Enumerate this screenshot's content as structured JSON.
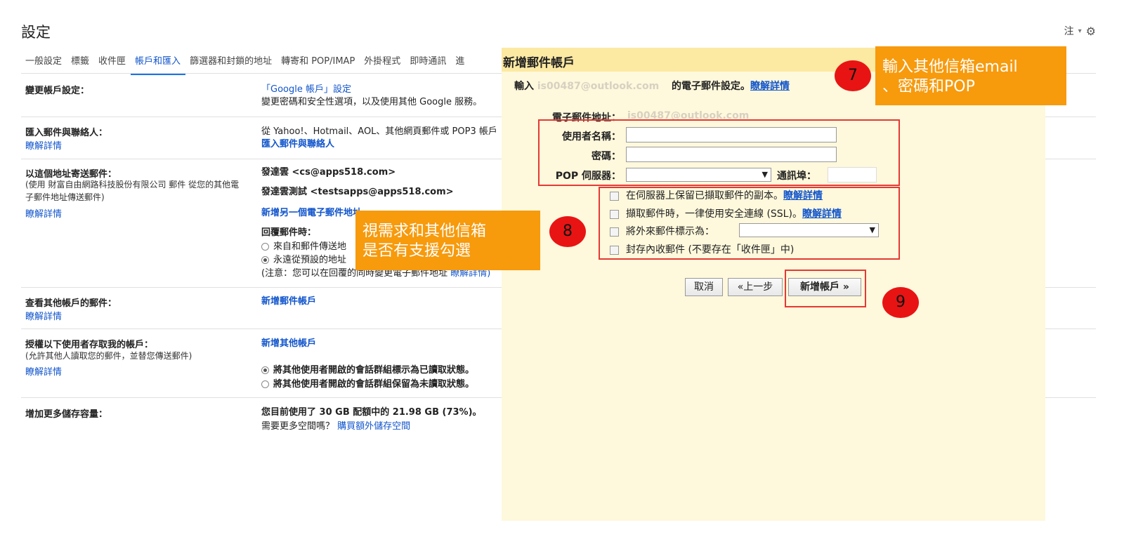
{
  "header": {
    "title": "設定",
    "notes_label": "注",
    "dropdown_caret": "▾"
  },
  "tabs": [
    "一般設定",
    "標籤",
    "收件匣",
    "帳戶和匯入",
    "篩選器和封鎖的地址",
    "轉寄和 POP/IMAP",
    "外掛程式",
    "即時通訊",
    "進"
  ],
  "active_tab_index": 3,
  "sections": {
    "change_account": {
      "title": "變更帳戶設定：",
      "link": "「Google 帳戶」設定",
      "desc": "變更密碼和安全性選項，以及使用其他 Google 服務。"
    },
    "import": {
      "title": "匯入郵件與聯絡人：",
      "learn": "瞭解詳情",
      "desc": "從 Yahoo!、Hotmail、AOL、其他網頁郵件或 POP3 帳戶",
      "link": "匯入郵件與聯絡人"
    },
    "send_as": {
      "title": "以這個地址寄送郵件：",
      "sub1": "(使用 財富自由網路科技股份有限公司 郵件 從您的其他電",
      "sub2": "子郵件地址傳送郵件)",
      "learn": "瞭解詳情",
      "addr1": "發達雲 <cs@apps518.com>",
      "addr2": "發達雲測試 <testsapps@apps518.com>",
      "add_link": "新增另一個電子郵件地址",
      "reply_title": "回覆郵件時：",
      "reply_opt1": "來自和郵件傳送地",
      "reply_opt2": "永遠從預設的地址",
      "note": "(注意：您可以在回覆的同時變更電子郵件地址",
      "note_link": "瞭解詳情)"
    },
    "check_mail": {
      "title": "查看其他帳戶的郵件：",
      "learn": "瞭解詳情",
      "link": "新增郵件帳戶"
    },
    "grant": {
      "title": "授權以下使用者存取我的帳戶：",
      "sub": "(允許其他人讀取您的郵件，並替您傳送郵件)",
      "learn": "瞭解詳情",
      "link": "新增其他帳戶",
      "opt1": "將其他使用者開啟的會話群組標示為已讀取狀態。",
      "opt2": "將其他使用者開啟的會話群組保留為未讀取狀態。"
    },
    "storage": {
      "title": "增加更多儲存容量：",
      "usage": "您目前使用了 30 GB 配額中的 21.98 GB (73%)。",
      "more": "需要更多空間嗎？",
      "buy_link": "購買額外儲存空間"
    }
  },
  "dialog": {
    "title": "新增郵件帳戶",
    "sub_prefix": "輸入",
    "sub_faded": "is00487@outlook.com",
    "sub_suffix": "的電子郵件設定。",
    "sub_link": "瞭解詳情",
    "email_label": "電子郵件地址：",
    "email_value": "is00487@outlook.com",
    "username_label": "使用者名稱：",
    "password_label": "密碼：",
    "pop_label": "POP 伺服器：",
    "port_label": "通訊埠：",
    "select_arrow": "▼",
    "options": [
      {
        "text": "在伺服器上保留已擷取郵件的副本。",
        "link": "瞭解詳情"
      },
      {
        "text": "擷取郵件時，一律使用安全連線 (SSL)。",
        "link": "瞭解詳情"
      },
      {
        "text": "將外來郵件標示為：",
        "link": ""
      },
      {
        "text": "封存內收郵件 (不要存在「收件匣」中)",
        "link": ""
      }
    ],
    "buttons": {
      "cancel": "取消",
      "back": "«上一步",
      "add": "新增帳戶 »"
    }
  },
  "annotations": {
    "step7": "7",
    "step8": "8",
    "step9": "9",
    "callout7_line1": "輸入其他信箱email",
    "callout7_line2": "、密碼和POP",
    "callout8_line1": "視需求和其他信箱",
    "callout8_line2": "是否有支援勾選"
  },
  "colors": {
    "accent": "#1a73e8",
    "link": "#1155cc",
    "dialog_bg": "#fef8dc",
    "dialog_header": "#fce9a2",
    "callout": "#f79a0c",
    "marker": "#e81414"
  }
}
